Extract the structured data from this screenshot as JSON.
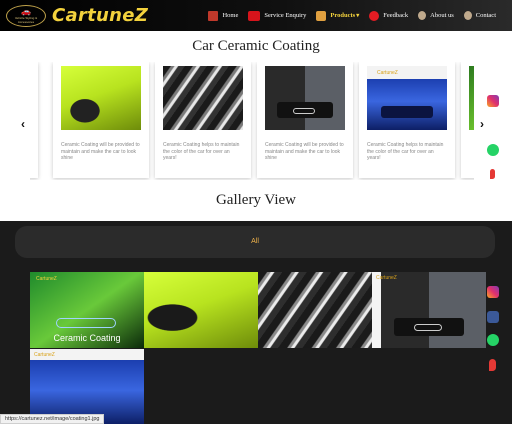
{
  "brand": {
    "name": "CartuneZ",
    "tagline": "Vehicle Styling & Accessories",
    "badge": "CZ"
  },
  "nav": {
    "items": [
      {
        "label": "Home",
        "icon": "home-icon",
        "color": "#c0392b"
      },
      {
        "label": "Service Enquiry",
        "icon": "service-enquiry-icon",
        "color": "#d6141b"
      },
      {
        "label": "Products",
        "icon": "products-icon",
        "color": "#e0a040"
      },
      {
        "label": "Feedback",
        "icon": "feedback-icon",
        "color": "#e51c23"
      },
      {
        "label": "About us",
        "icon": "about-icon",
        "color": "#bfa98c"
      },
      {
        "label": "Contact",
        "icon": "contact-icon",
        "color": "#bfa98c"
      }
    ],
    "products_caret": "▾"
  },
  "ceramic": {
    "title": "Car Ceramic Coating",
    "cards": [
      {
        "desc": "Ceramic Coating will be provided to maintain and make the car to look shine"
      },
      {
        "desc": "Ceramic Coating helps to maintain the color of the car for over an years!"
      },
      {
        "desc": "Ceramic Coating will be provided to maintain and make the car to look shine"
      },
      {
        "desc": "Ceramic Coating helps to maintain the color of the car for over an years!"
      }
    ],
    "prev": "‹",
    "next": "›"
  },
  "gallery": {
    "title": "Gallery View",
    "filter_all": "All",
    "first_caption": "Ceramic Coating",
    "watermark": "CartuneZ"
  },
  "status_url": "https://cartunez.net/image/coating1.jpg",
  "colors": {
    "brand_yellow": "#f3d23d",
    "filter_orange": "#f0b24a",
    "nav_bg": "#000000"
  }
}
